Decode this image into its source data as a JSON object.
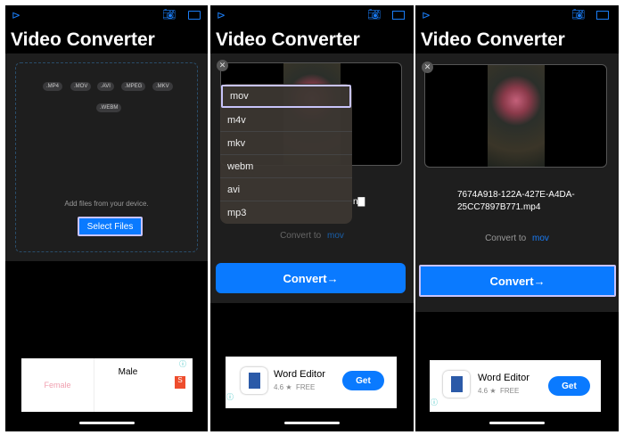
{
  "app_title": "Video Converter",
  "panel1": {
    "formats": [
      ".MP4",
      ".MOV",
      ".AVI",
      ".MPEG",
      ".MKV",
      ".WEBM"
    ],
    "hint": "Add files from your device.",
    "select_label": "Select Files",
    "ad": {
      "female": "Female",
      "male": "Male",
      "brand": "Shopee"
    }
  },
  "panel2": {
    "menu": [
      "mov",
      "m4v",
      "mkv",
      "webm",
      "avi",
      "mp3"
    ],
    "convert_to": "Convert to",
    "format": "mov",
    "convert_label": "Convert",
    "arrow": "→"
  },
  "panel3": {
    "filename": "7674A918-122A-427E-A4DA-25CC7897B771.mp4",
    "convert_to": "Convert to",
    "format": "mov",
    "convert_label": "Convert",
    "arrow": "→"
  },
  "ad": {
    "name": "Word Editor",
    "rating": "4.6 ★",
    "price": "FREE",
    "get": "Get"
  },
  "colors": {
    "accent": "#0a7aff",
    "highlight": "#a9a4f5",
    "bg": "#1e1e1e"
  }
}
